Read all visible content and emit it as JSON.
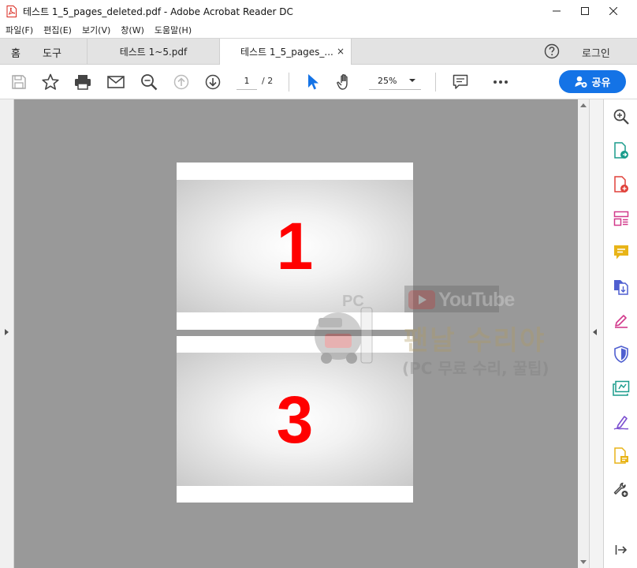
{
  "window": {
    "title": "테스트 1_5_pages_deleted.pdf - Adobe Acrobat Reader DC"
  },
  "menu": [
    "파일(F)",
    "편집(E)",
    "보기(V)",
    "창(W)",
    "도움말(H)"
  ],
  "tabs": {
    "home": "홈",
    "tools": "도구",
    "documents": [
      {
        "label": "테스트 1~5.pdf"
      },
      {
        "label": "테스트 1_5_pages_...",
        "close": "×"
      }
    ],
    "login": "로그인"
  },
  "toolbar": {
    "current_page": "1",
    "total_pages": "/ 2",
    "zoom": "25%",
    "share_label": "공유"
  },
  "document": {
    "pages": [
      {
        "number": "1"
      },
      {
        "number": "3"
      }
    ]
  },
  "watermark": {
    "youtube": "YouTube",
    "channel": "팬날 수리야",
    "subtitle": "(PC 무료 수리, 꿀팁)"
  },
  "icons": {
    "toolbar": [
      "save-icon",
      "star-icon",
      "print-icon",
      "email-icon",
      "zoom-search-icon",
      "page-up-icon",
      "page-down-icon",
      "select-arrow-icon",
      "hand-icon",
      "comment-icon",
      "more-icon"
    ],
    "right_panel": [
      "zoom-icon",
      "export-pdf-icon",
      "create-pdf-icon",
      "organize-pages-icon",
      "comment-icon",
      "combine-files-icon",
      "fill-sign-icon",
      "protect-icon",
      "send-for-review-icon",
      "sign-icon",
      "certificate-icon",
      "more-tools-icon",
      "expand-panel-icon"
    ]
  },
  "colors": {
    "accent": "#1473e6",
    "page_number": "#ff0000",
    "doc_background": "#999999"
  }
}
